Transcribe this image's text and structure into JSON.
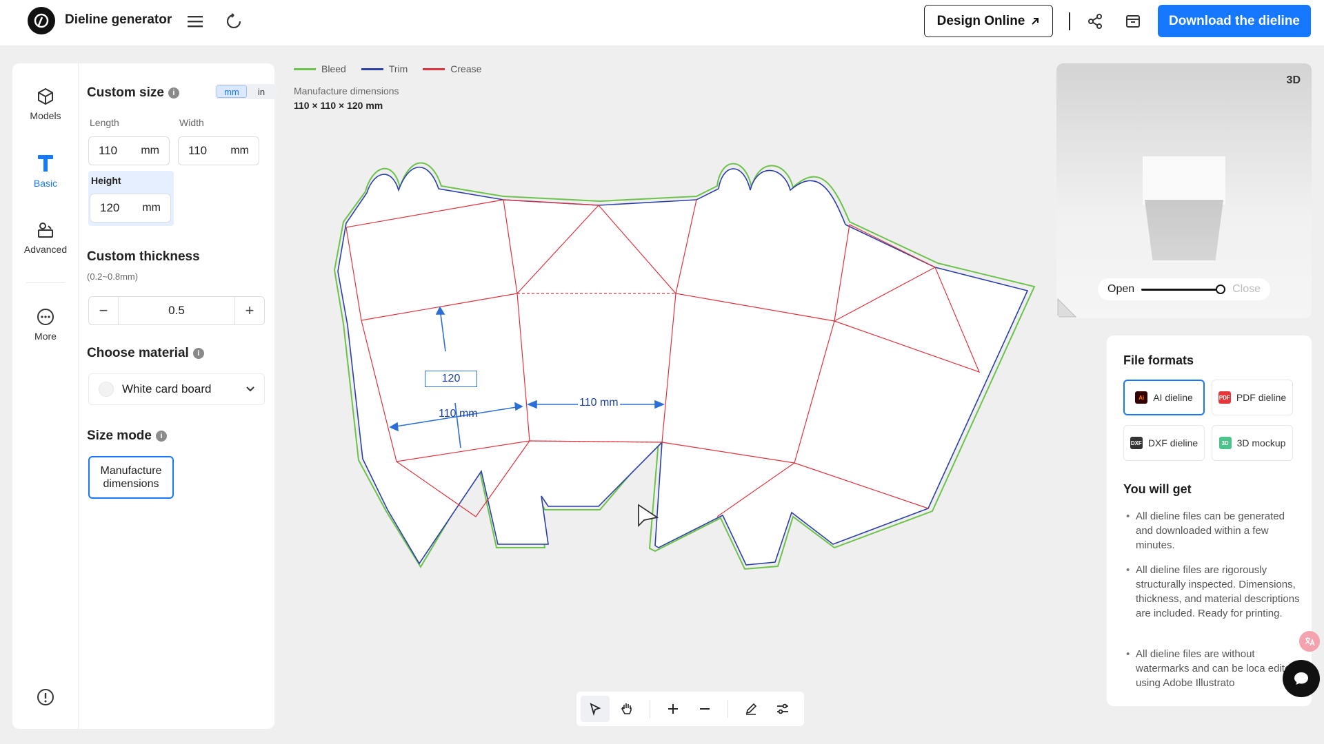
{
  "header": {
    "app_title": "Dieline generator",
    "design_online": "Design Online",
    "download": "Download the dieline"
  },
  "rail": {
    "models": "Models",
    "basic": "Basic",
    "advanced": "Advanced",
    "more": "More"
  },
  "panel": {
    "custom_size": "Custom size",
    "unit_mm": "mm",
    "unit_in": "in",
    "length_label": "Length",
    "length_value": "110",
    "length_unit": "mm",
    "width_label": "Width",
    "width_value": "110",
    "width_unit": "mm",
    "height_label": "Height",
    "height_value": "120",
    "height_unit": "mm",
    "thickness_title": "Custom thickness",
    "thickness_range": "(0.2~0.8mm)",
    "thickness_value": "0.5",
    "material_title": "Choose material",
    "material_value": "White card board",
    "size_mode_title": "Size mode",
    "size_mode_value": "Manufacture dimensions"
  },
  "canvas": {
    "legend": [
      {
        "label": "Bleed",
        "color": "#6cc24a"
      },
      {
        "label": "Trim",
        "color": "#2b3fa8"
      },
      {
        "label": "Crease",
        "color": "#e0323c"
      }
    ],
    "dim_caption": "Manufacture dimensions",
    "dim_value": "110 × 110 × 120 mm",
    "label_height": "120",
    "label_length": "110 mm",
    "label_width": "110 mm"
  },
  "preview": {
    "badge": "3D",
    "open": "Open",
    "close": "Close",
    "open_close_level": 1.0
  },
  "formats": {
    "title": "File formats",
    "items": [
      {
        "label": "AI dieline",
        "icon_text": "Ai",
        "color": "#ff7a00",
        "bg": "#330000"
      },
      {
        "label": "PDF dieline",
        "icon_text": "PDF",
        "color": "#ffffff",
        "bg": "#e5363a"
      },
      {
        "label": "DXF dieline",
        "icon_text": "DXF",
        "color": "#ffffff",
        "bg": "#333333"
      },
      {
        "label": "3D mockup",
        "icon_text": "3D",
        "color": "#ffffff",
        "bg": "#4cc38a"
      }
    ],
    "you_will_get": "You will get",
    "bullets": [
      "All dieline files can be generated and downloaded within a few minutes.",
      "All dieline files are rigorously structurally inspected. Dimensions, thickness, and material descriptions are included. Ready for printing.",
      "All dieline files are without watermarks and can be loca edited using Adobe Illustrato"
    ]
  },
  "colors": {
    "accent": "#1677ff",
    "bleed": "#6cc24a",
    "trim": "#2b3fa8",
    "crease": "#e0323c"
  }
}
